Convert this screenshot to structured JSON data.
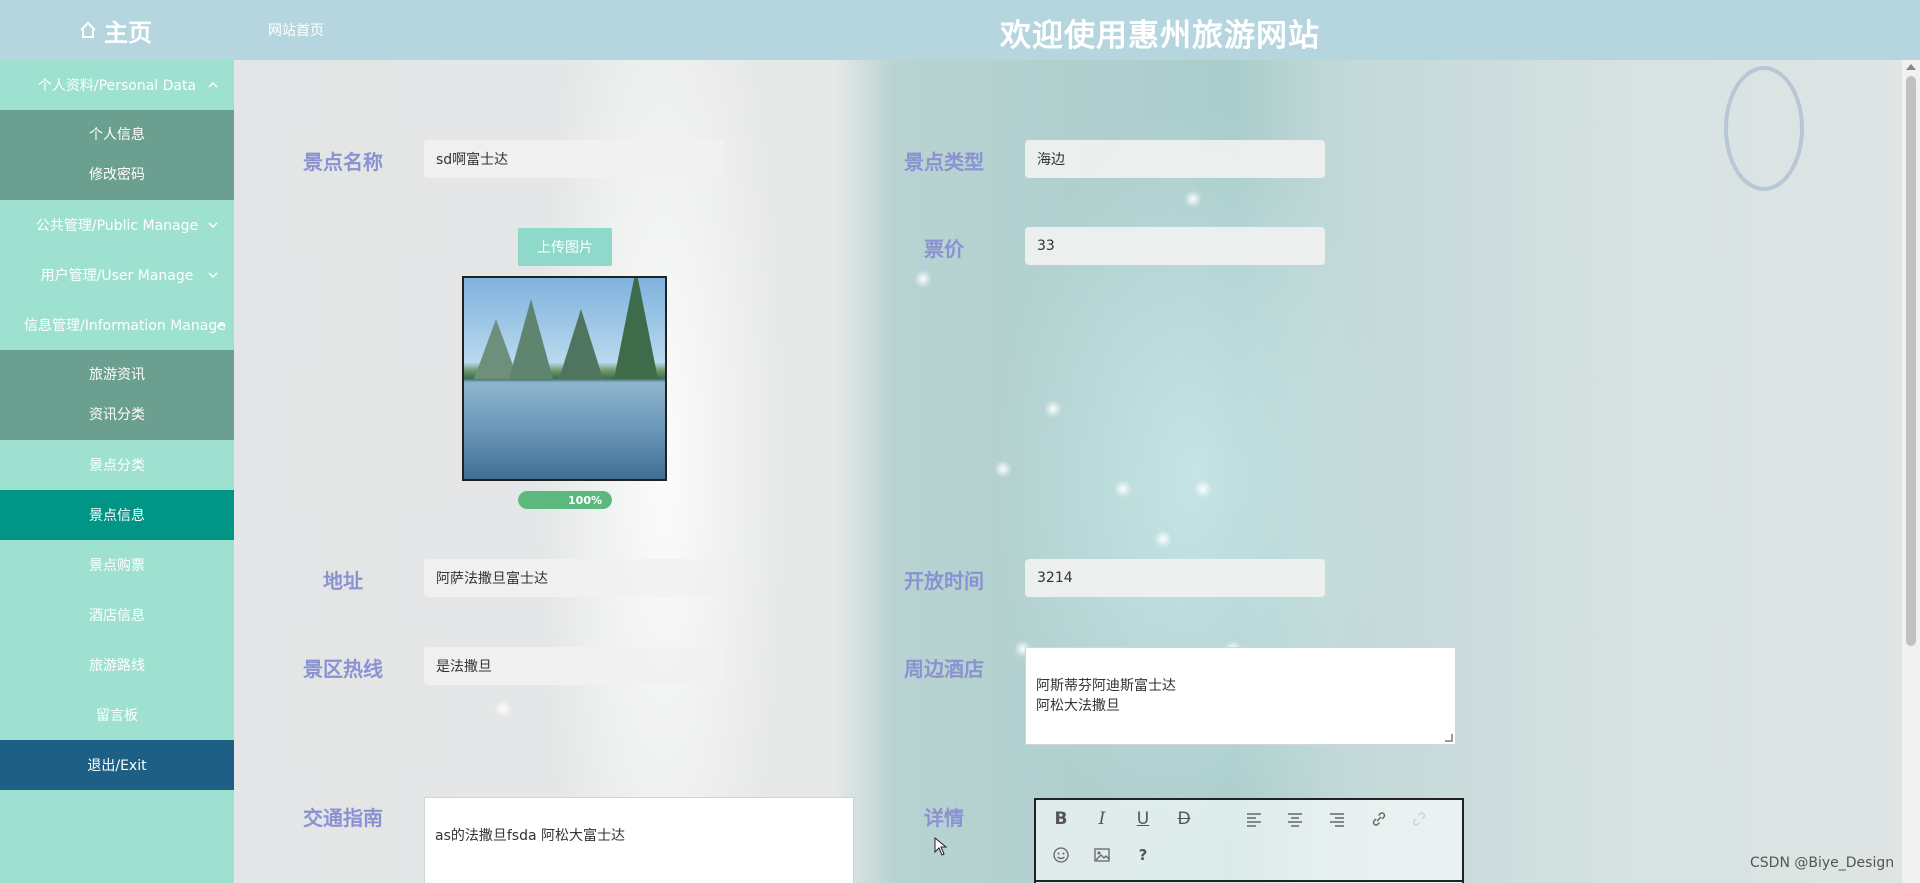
{
  "header": {
    "home_label": "主页",
    "site_home_link": "网站首页",
    "welcome_title": "欢迎使用惠州旅游网站"
  },
  "sidebar": {
    "personal": {
      "label": "个人资料/Personal Data",
      "items": [
        "个人信息",
        "修改密码"
      ]
    },
    "public_manage": "公共管理/Public Manage",
    "user_manage": "用户管理/User Manage",
    "info_manage": {
      "label": "信息管理/Information Manage",
      "items": [
        "旅游资讯",
        "资讯分类"
      ]
    },
    "scenic_category": "景点分类",
    "scenic_info": "景点信息",
    "scenic_tickets": "景点购票",
    "hotel_info": "酒店信息",
    "travel_routes": "旅游路线",
    "message_board": "留言板",
    "exit": "退出/Exit"
  },
  "form": {
    "name": {
      "label": "景点名称",
      "value": "sd啊富士达"
    },
    "type": {
      "label": "景点类型",
      "value": "海边"
    },
    "upload_button": "上传图片",
    "upload_progress": "100%",
    "upload_progress_value": 100,
    "price": {
      "label": "票价",
      "value": "33"
    },
    "address": {
      "label": "地址",
      "value": "阿萨法撒旦富士达"
    },
    "open_time": {
      "label": "开放时间",
      "value": "3214"
    },
    "hotline": {
      "label": "景区热线",
      "value": "是法撒旦"
    },
    "nearby_hotels": {
      "label": "周边酒店",
      "value": "阿斯蒂芬阿迪斯富士达\n阿松大法撒旦"
    },
    "transport": {
      "label": "交通指南",
      "value": "as的法撒旦fsda 阿松大富士达"
    },
    "details": {
      "label": "详情"
    }
  },
  "editor_toolbar": [
    "bold-icon",
    "italic-icon",
    "underline-icon",
    "strikethrough-icon",
    "align-left-icon",
    "align-center-icon",
    "align-right-icon",
    "link-icon",
    "unlink-icon",
    "emoji-icon",
    "image-icon",
    "help-icon"
  ],
  "watermark": "CSDN @Biye_Design",
  "colors": {
    "header_bg": "#b6d6df",
    "sidebar_bg": "#9ee1d0",
    "submenu_bg": "#6b9f8f",
    "active_bg": "#009585",
    "exit_bg": "#1e5f85",
    "label_color": "#8a92d2"
  }
}
